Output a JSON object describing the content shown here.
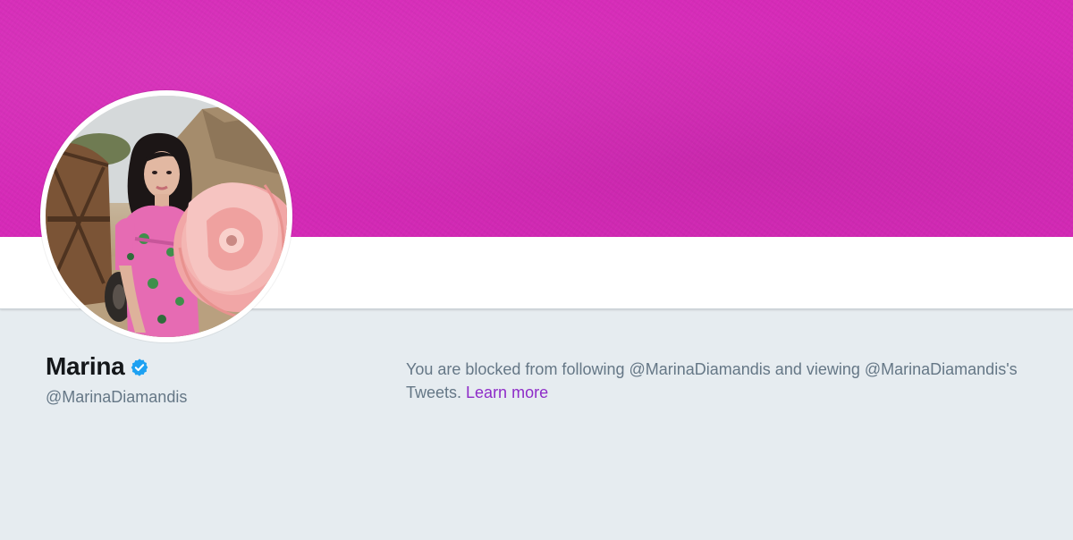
{
  "colors": {
    "banner": "#d62ab8",
    "page_background": "#e6ecf0",
    "link": "#8e2cc8",
    "verified": "#1da1f2",
    "name": "#14171a",
    "muted": "#657786"
  },
  "profile": {
    "name": "Marina",
    "handle": "@MarinaDiamandis",
    "verified_icon": "verified-badge-icon",
    "avatar_description_icon": "avatar-photo"
  },
  "blocked_notice": {
    "message": "You are blocked from following @MarinaDiamandis and viewing @MarinaDiamandis's Tweets.",
    "learn_more_label": "Learn more"
  }
}
